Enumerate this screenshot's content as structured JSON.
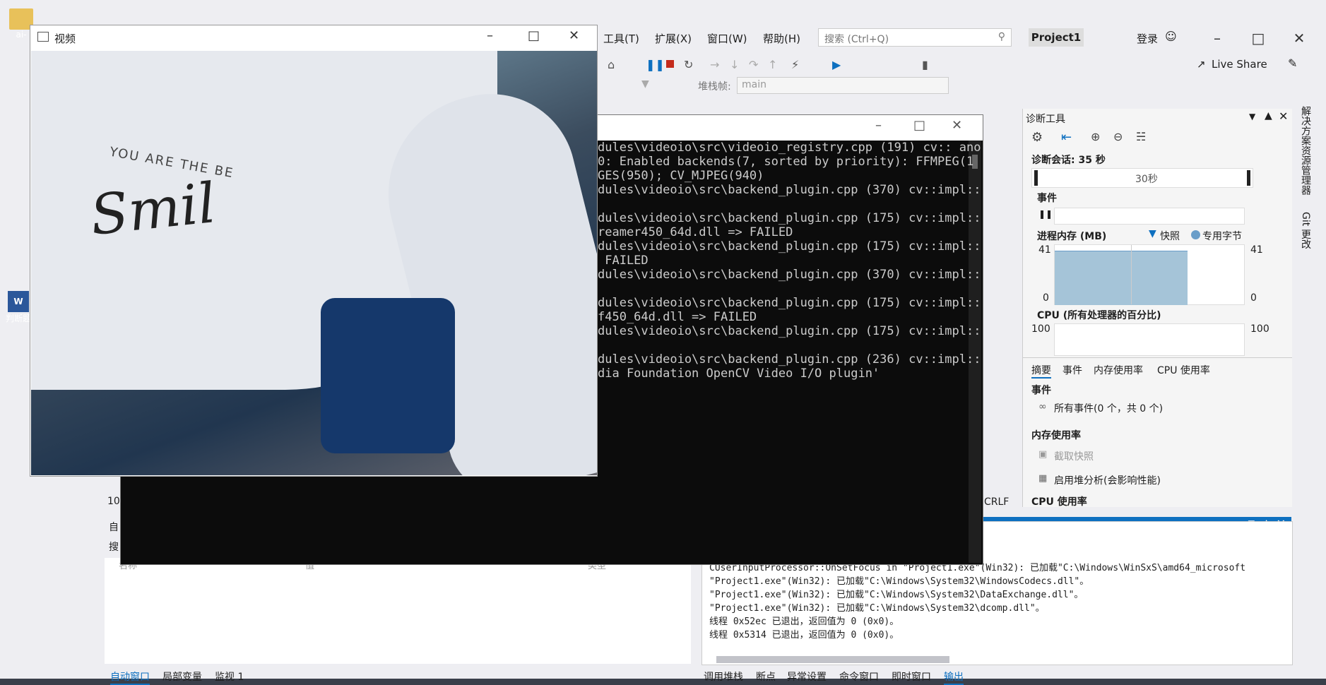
{
  "desktop": {
    "icons": [
      {
        "label": "ai-"
      },
      {
        "label": "判断题"
      }
    ]
  },
  "vs": {
    "menu": [
      "工具(T)",
      "扩展(X)",
      "窗口(W)",
      "帮助(H)"
    ],
    "search_placeholder": "搜索 (Ctrl+Q)",
    "project_title": "Project1",
    "login": "登录",
    "live_share": "Live Share",
    "stackframe_label": "堆栈帧:",
    "stackframe_value": "main",
    "crlf": "CRLF"
  },
  "diag": {
    "title": "诊断工具",
    "session": "诊断会话: 35 秒",
    "timeline_label": "30秒",
    "events_header": "事件",
    "memory_header": "进程内存 (MB)",
    "snapshot": "快照",
    "private_bytes": "专用字节",
    "mem_max_left": "41",
    "mem_min_left": "0",
    "mem_max_right": "41",
    "mem_min_right": "0",
    "cpu_header": "CPU (所有处理器的百分比)",
    "cpu_max_left": "100",
    "cpu_max_right": "100",
    "tabs": [
      "摘要",
      "事件",
      "内存使用率",
      "CPU 使用率"
    ],
    "section_events": "事件",
    "all_events": "所有事件(0 个，共 0 个)",
    "section_memory": "内存使用率",
    "take_snapshot": "截取快照",
    "heap_analysis": "启用堆分析(会影响性能)",
    "section_cpu": "CPU 使用率"
  },
  "side_tabs": [
    "解决方案资源管理器",
    "Git 更改"
  ],
  "output": {
    "lines": [
      "CUserInputProcessor::OnSetFocus in \"Project1.exe\"(Win32): 已加载\"C:\\Windows\\WinSxS\\amd64_microsoft",
      "\"Project1.exe\"(Win32): 已加载\"C:\\Windows\\System32\\WindowsCodecs.dll\"。",
      "\"Project1.exe\"(Win32): 已加载\"C:\\Windows\\System32\\DataExchange.dll\"。",
      "\"Project1.exe\"(Win32): 已加载\"C:\\Windows\\System32\\dcomp.dll\"。",
      "线程 0x52ec 已退出，返回值为 0 (0x0)。",
      "线程 0x5314 已退出，返回值为 0 (0x0)。"
    ]
  },
  "bottom_tabs_left": [
    "自动窗口",
    "局部变量",
    "监视 1"
  ],
  "bottom_tabs_right": [
    "调用堆栈",
    "断点",
    "异常设置",
    "命令窗口",
    "即时窗口",
    "输出"
  ],
  "locals": {
    "col_name": "名称",
    "col_value": "值",
    "col_type": "类型",
    "label_auto": "自",
    "label_search": "搜",
    "label_num": "10"
  },
  "console": {
    "lines": [
      "dules\\videoio\\src\\videoio_registry.cpp (191) cv:: ano",
      "0: Enabled backends(7, sorted by priority): FFMPEG(1",
      "GES(950); CV_MJPEG(940)",
      "dules\\videoio\\src\\backend_plugin.cpp (370) cv::impl::",
      "",
      "dules\\videoio\\src\\backend_plugin.cpp (175) cv::impl::",
      "reamer450_64d.dll => FAILED",
      "dules\\videoio\\src\\backend_plugin.cpp (175) cv::impl::",
      " FAILED",
      "dules\\videoio\\src\\backend_plugin.cpp (370) cv::impl::",
      "",
      "dules\\videoio\\src\\backend_plugin.cpp (175) cv::impl::",
      "f450_64d.dll => FAILED",
      "dules\\videoio\\src\\backend_plugin.cpp (175) cv::impl::",
      "",
      "dules\\videoio\\src\\backend_plugin.cpp (236) cv::impl::",
      "dia Foundation OpenCV Video I/O plugin'"
    ]
  },
  "video": {
    "title": "视频",
    "shirt_text_top": "YOU ARE THE BE",
    "shirt_text_main": "Smil"
  }
}
